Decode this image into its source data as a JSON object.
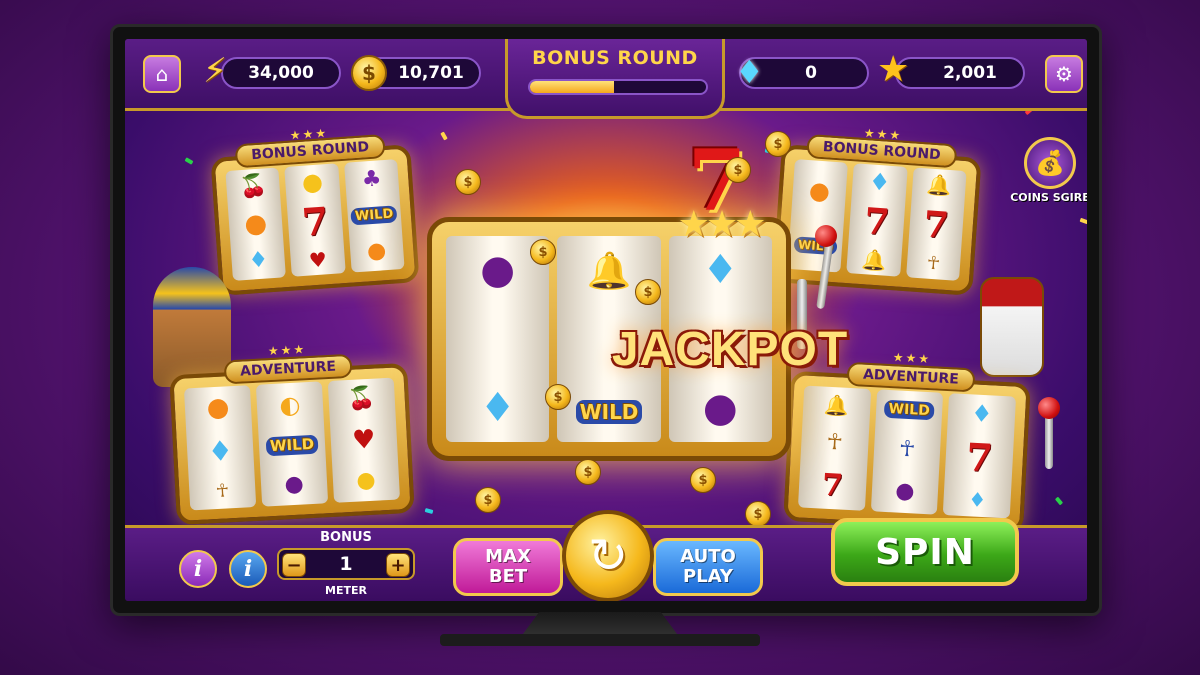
{
  "top_bar": {
    "home_icon": "home-icon",
    "energy_value": "34,000",
    "coins_value": "10,701",
    "bonus_round_label": "BONUS ROUND",
    "bonus_progress": 0.48,
    "gems_value": "0",
    "stars_value": "2,001",
    "settings_icon": "gear-icon"
  },
  "machines": {
    "top_left_title": "BONUS ROUND",
    "top_right_title": "BONUS ROUND",
    "bottom_left_title": "ADVENTURE",
    "bottom_right_title": "ADVENTURE",
    "center_jackpot": "JACKPOT",
    "wild_label": "WILD",
    "seven": "7"
  },
  "coins_store": {
    "label": "COINS SGIRE"
  },
  "bottom_bar": {
    "bonus_label": "BONUS",
    "meter_label": "METER",
    "meter_value": "1",
    "minus": "−",
    "plus": "+",
    "info_glyph": "i",
    "max_bet_line1": "MAX",
    "max_bet_line2": "BET",
    "auto_play_line1": "AUTO",
    "auto_play_line2": "PLAY",
    "spin_label": "SPIN"
  },
  "colors": {
    "gold": "#f2c94c",
    "purple": "#5a1d86",
    "spin_green": "#3ca818",
    "auto_blue": "#2a7ae0",
    "max_pink": "#d02aa8"
  }
}
